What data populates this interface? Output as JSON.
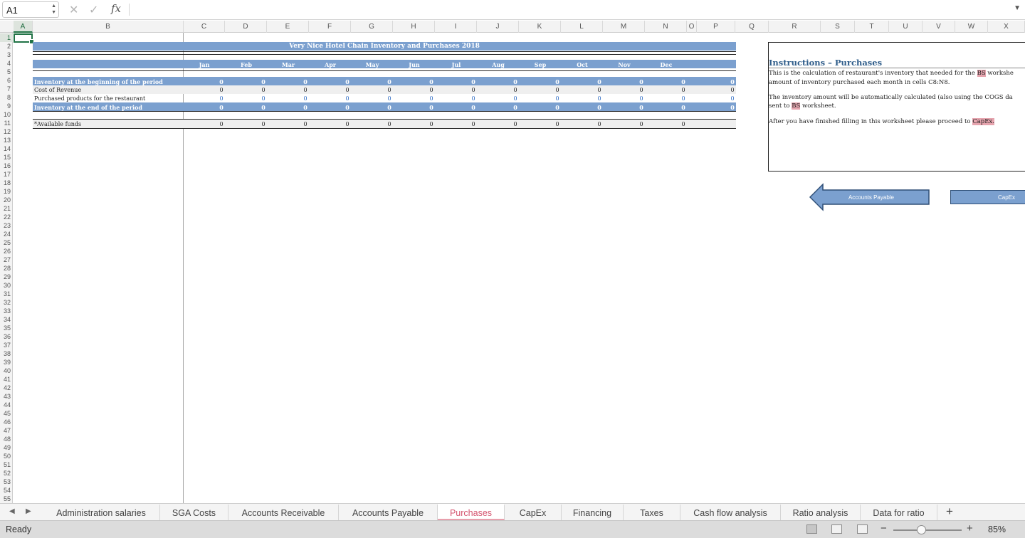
{
  "formula_bar": {
    "name_box": "A1",
    "cancel_icon": "✕",
    "enter_icon": "✓",
    "fx": "fx",
    "content": ""
  },
  "columns": [
    "A",
    "B",
    "C",
    "D",
    "E",
    "F",
    "G",
    "H",
    "I",
    "J",
    "K",
    "L",
    "M",
    "N",
    "O",
    "P",
    "Q",
    "R",
    "S",
    "T",
    "U",
    "V",
    "W",
    "X"
  ],
  "rows": [
    "1",
    "2",
    "3",
    "4",
    "5",
    "6",
    "7",
    "8",
    "9",
    "10",
    "11",
    "12",
    "13",
    "14",
    "15",
    "16",
    "17",
    "18",
    "19",
    "20",
    "21",
    "22",
    "23",
    "24",
    "25",
    "26",
    "27",
    "28",
    "29",
    "30",
    "31",
    "32",
    "33",
    "34",
    "35",
    "36",
    "37",
    "38",
    "39",
    "40",
    "41",
    "42",
    "43",
    "44",
    "45",
    "46",
    "47",
    "48",
    "49",
    "50",
    "51",
    "52",
    "53",
    "54",
    "55"
  ],
  "sheet": {
    "title": "Very Nice Hotel Chain Inventory and Purchases 2018",
    "months": [
      "Jan",
      "Feb",
      "Mar",
      "Apr",
      "May",
      "Jun",
      "Jul",
      "Aug",
      "Sep",
      "Oct",
      "Nov",
      "Dec"
    ],
    "row_labels": {
      "inv_begin": "Inventory at the beginning of the period",
      "cost_rev": "Cost of Revenue",
      "purchased": "Purchased products for the restaurant",
      "inv_end": "Inventory at the end of the period",
      "avail": "*Available funds"
    },
    "values": {
      "inv_begin": [
        "0",
        "0",
        "0",
        "0",
        "0",
        "0",
        "0",
        "0",
        "0",
        "0",
        "0",
        "0",
        "0"
      ],
      "cost_rev": [
        "0",
        "0",
        "0",
        "0",
        "0",
        "0",
        "0",
        "0",
        "0",
        "0",
        "0",
        "0",
        "0"
      ],
      "purchased": [
        "0",
        "0",
        "0",
        "0",
        "0",
        "0",
        "0",
        "0",
        "0",
        "0",
        "0",
        "0",
        "0"
      ],
      "inv_end": [
        "0",
        "0",
        "0",
        "0",
        "0",
        "0",
        "0",
        "0",
        "0",
        "0",
        "0",
        "0",
        "0"
      ],
      "avail": [
        "0",
        "0",
        "0",
        "0",
        "0",
        "0",
        "0",
        "0",
        "0",
        "0",
        "0",
        "0"
      ]
    }
  },
  "instructions": {
    "title": "Instructions – Purchases",
    "p1_a": "This is the calculation of restaurant's inventory that needed for the ",
    "p1_hl": "BS",
    "p1_b": " workshe",
    "p1_line2": "amount of inventory purchased each month in cells C8:N8.",
    "p2_line1": "The inventory amount will be automatically calculated (also using the COGS da",
    "p2_a": "sent to ",
    "p2_hl": "BS",
    "p2_b": " worksheet.",
    "p3_a": "After you have finished filling in this worksheet please proceed to ",
    "p3_hl": "CapEx."
  },
  "nav_buttons": {
    "back": "Accounts Payable",
    "next": "CapEx"
  },
  "tabs": [
    "Administration salaries",
    "SGA Costs",
    "Accounts Receivable",
    "Accounts Payable",
    "Purchases",
    "CapEx",
    "Financing",
    "Taxes",
    "Cash flow analysis",
    "Ratio analysis",
    "Data for ratio"
  ],
  "active_tab": "Purchases",
  "add_tab": "+",
  "tab_nav": {
    "prev": "◀",
    "next": "▶"
  },
  "status": {
    "ready": "Ready",
    "zoom": "85%",
    "zoom_minus": "−",
    "zoom_plus": "+"
  },
  "colors": {
    "accent_band": "#7ba0cf",
    "active_tab": "#d4546f",
    "excel_green": "#217346",
    "highlight": "#e6a4ae"
  }
}
